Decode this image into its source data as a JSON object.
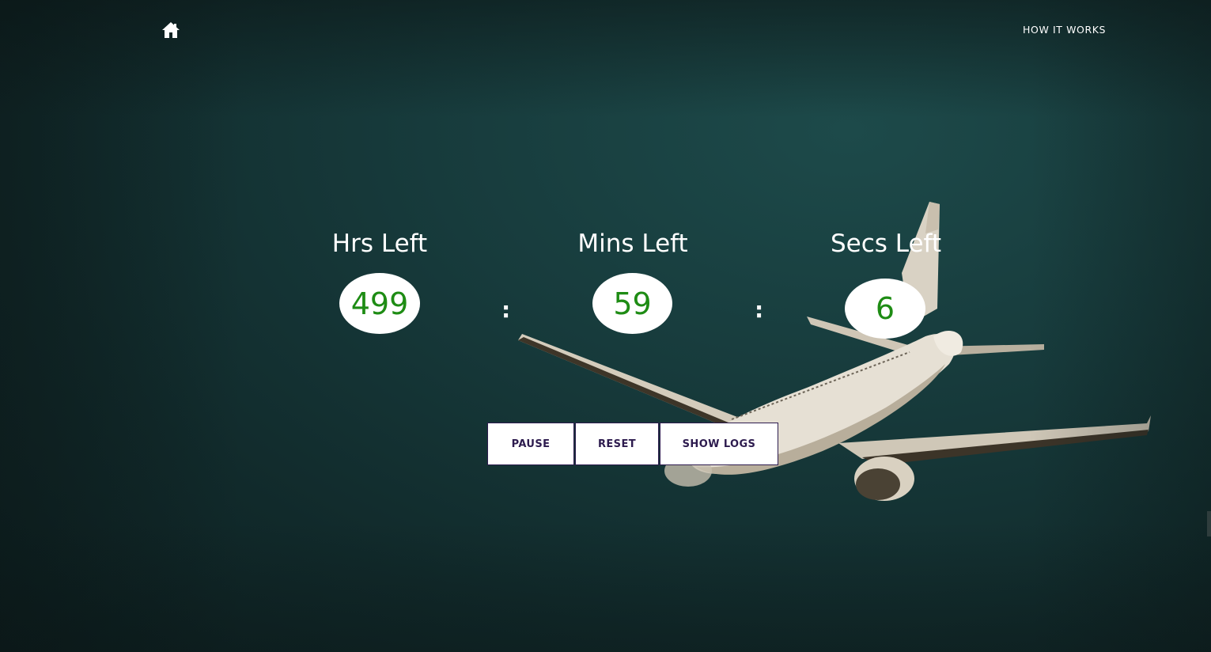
{
  "nav": {
    "home_icon": "home-icon",
    "how_it_works": "HOW IT WORKS"
  },
  "timer": {
    "hours": {
      "label": "Hrs Left",
      "value": "499"
    },
    "minutes": {
      "label": "Mins Left",
      "value": "59"
    },
    "seconds": {
      "label": "Secs Left",
      "value": "6"
    },
    "separator": ":"
  },
  "controls": {
    "pause_label": "PAUSE",
    "reset_label": "RESET",
    "show_logs_label": "SHOW LOGS"
  },
  "colors": {
    "background": "#173b3c",
    "value_text": "#1e8c14",
    "button_text": "#2d1b4e",
    "bubble": "#ffffff"
  },
  "background_image": "airplane-in-sky"
}
